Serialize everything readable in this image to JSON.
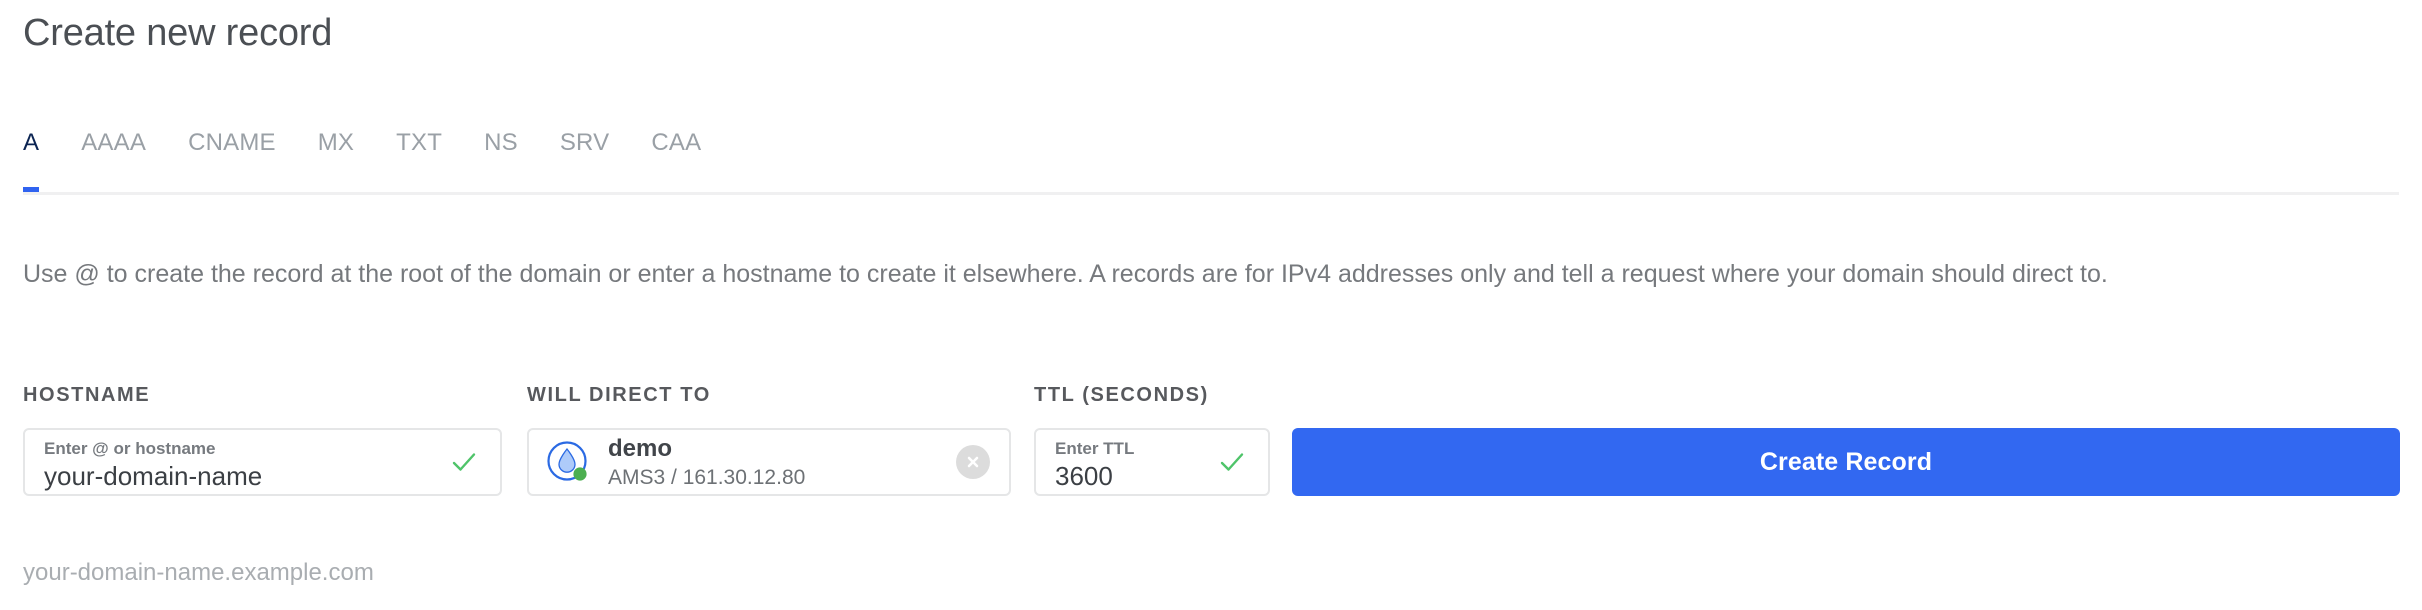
{
  "header": {
    "title": "Create new record"
  },
  "tabs": {
    "active_index": 0,
    "items": [
      {
        "label": "A"
      },
      {
        "label": "AAAA"
      },
      {
        "label": "CNAME"
      },
      {
        "label": "MX"
      },
      {
        "label": "TXT"
      },
      {
        "label": "NS"
      },
      {
        "label": "SRV"
      },
      {
        "label": "CAA"
      }
    ]
  },
  "description": "Use @ to create the record at the root of the domain or enter a hostname to create it elsewhere. A records are for IPv4 addresses only and tell a request where your domain should direct to.",
  "form": {
    "hostname": {
      "label": "HOSTNAME",
      "placeholder": "Enter @ or hostname",
      "value": "your-domain-name",
      "valid_icon": "check-icon"
    },
    "target": {
      "label": "WILL DIRECT TO",
      "icon": "droplet-icon",
      "status": "active",
      "name": "demo",
      "detail": "AMS3 / 161.30.12.80",
      "clear_icon": "close-circle-icon"
    },
    "ttl": {
      "label": "TTL (SECONDS)",
      "placeholder": "Enter TTL",
      "value": "3600",
      "valid_icon": "check-icon"
    },
    "submit_label": "Create Record"
  },
  "helper_text": "your-domain-name.example.com",
  "colors": {
    "accent_blue": "#3268f1",
    "active_tab": "#0c2553",
    "valid_green": "#4fc46a",
    "status_green": "#4caf50",
    "droplet_blue": "#2b6ae3",
    "droplet_fill": "#aecbfa",
    "border": "#e5e6e7",
    "muted_text": "#9aa0a6"
  }
}
